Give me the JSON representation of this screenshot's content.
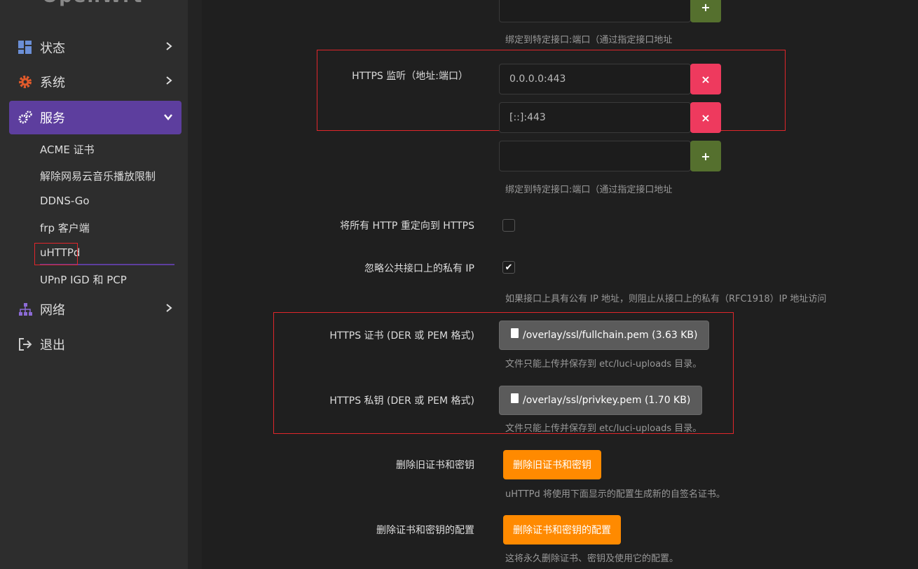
{
  "logo_text": "OpenWrt",
  "sidebar": {
    "items": [
      {
        "label": "状态",
        "icon": "dashboard-icon"
      },
      {
        "label": "系统",
        "icon": "gear-icon"
      },
      {
        "label": "服务",
        "icon": "gears-icon"
      },
      {
        "label": "网络",
        "icon": "network-icon"
      },
      {
        "label": "退出",
        "icon": "logout-icon"
      }
    ],
    "sub_items": [
      "ACME 证书",
      "解除网易云音乐播放限制",
      "DDNS-Go",
      "frp 客户端",
      "uHTTPd",
      "UPnP IGD 和 PCP"
    ]
  },
  "form": {
    "http_hint": "绑定到特定接口:端口（通过指定接口地址",
    "https_listen_label": "HTTPS 监听（地址:端口）",
    "https_listen_values": [
      "0.0.0.0:443",
      "[::]:443"
    ],
    "https_hint": "绑定到特定接口:端口（通过指定接口地址",
    "redirect_label": "将所有 HTTP 重定向到 HTTPS",
    "redirect_checked": false,
    "ignore_private_label": "忽略公共接口上的私有 IP",
    "ignore_private_checked": true,
    "ignore_private_hint": "如果接口上具有公有 IP 地址，则阻止从接口上的私有（RFC1918）IP 地址访问",
    "cert_label": "HTTPS 证书 (DER 或 PEM 格式)",
    "cert_file": "/overlay/ssl/fullchain.pem (3.63 KB)",
    "cert_hint": "文件只能上传并保存到 etc/luci-uploads 目录。",
    "key_label": "HTTPS 私钥 (DER 或 PEM 格式)",
    "key_file": "/overlay/ssl/privkey.pem (1.70 KB)",
    "key_hint": "文件只能上传并保存到 etc/luci-uploads 目录。",
    "remove_old_label": "删除旧证书和密钥",
    "remove_old_button": "删除旧证书和密钥",
    "remove_old_hint": "uHTTPd 将使用下面显示的配置生成新的自签名证书。",
    "remove_conf_label": "删除证书和密钥的配置",
    "remove_conf_button": "删除证书和密钥的配置",
    "remove_conf_hint": "这将永久删除证书、密钥及使用它的配置。"
  },
  "colors": {
    "accent": "#5d3e9e",
    "add": "#55702e",
    "delete": "#ee3a5e",
    "orange": "#ff8a00",
    "highlight": "#e0262b"
  }
}
